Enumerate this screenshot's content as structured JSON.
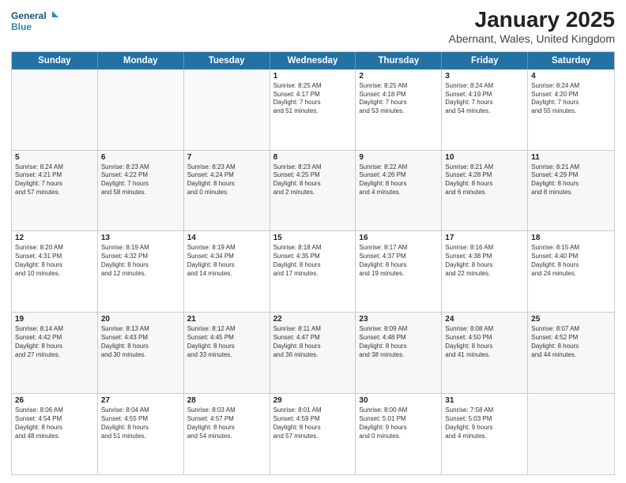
{
  "header": {
    "logo_line1": "General",
    "logo_line2": "Blue",
    "title": "January 2025",
    "subtitle": "Abernant, Wales, United Kingdom"
  },
  "days": [
    "Sunday",
    "Monday",
    "Tuesday",
    "Wednesday",
    "Thursday",
    "Friday",
    "Saturday"
  ],
  "weeks": [
    [
      {
        "day": "",
        "info": ""
      },
      {
        "day": "",
        "info": ""
      },
      {
        "day": "",
        "info": ""
      },
      {
        "day": "1",
        "info": "Sunrise: 8:25 AM\nSunset: 4:17 PM\nDaylight: 7 hours\nand 51 minutes."
      },
      {
        "day": "2",
        "info": "Sunrise: 8:25 AM\nSunset: 4:18 PM\nDaylight: 7 hours\nand 53 minutes."
      },
      {
        "day": "3",
        "info": "Sunrise: 8:24 AM\nSunset: 4:19 PM\nDaylight: 7 hours\nand 54 minutes."
      },
      {
        "day": "4",
        "info": "Sunrise: 8:24 AM\nSunset: 4:20 PM\nDaylight: 7 hours\nand 55 minutes."
      }
    ],
    [
      {
        "day": "5",
        "info": "Sunrise: 8:24 AM\nSunset: 4:21 PM\nDaylight: 7 hours\nand 57 minutes."
      },
      {
        "day": "6",
        "info": "Sunrise: 8:23 AM\nSunset: 4:22 PM\nDaylight: 7 hours\nand 58 minutes."
      },
      {
        "day": "7",
        "info": "Sunrise: 8:23 AM\nSunset: 4:24 PM\nDaylight: 8 hours\nand 0 minutes."
      },
      {
        "day": "8",
        "info": "Sunrise: 8:23 AM\nSunset: 4:25 PM\nDaylight: 8 hours\nand 2 minutes."
      },
      {
        "day": "9",
        "info": "Sunrise: 8:22 AM\nSunset: 4:26 PM\nDaylight: 8 hours\nand 4 minutes."
      },
      {
        "day": "10",
        "info": "Sunrise: 8:21 AM\nSunset: 4:28 PM\nDaylight: 8 hours\nand 6 minutes."
      },
      {
        "day": "11",
        "info": "Sunrise: 8:21 AM\nSunset: 4:29 PM\nDaylight: 8 hours\nand 8 minutes."
      }
    ],
    [
      {
        "day": "12",
        "info": "Sunrise: 8:20 AM\nSunset: 4:31 PM\nDaylight: 8 hours\nand 10 minutes."
      },
      {
        "day": "13",
        "info": "Sunrise: 8:19 AM\nSunset: 4:32 PM\nDaylight: 8 hours\nand 12 minutes."
      },
      {
        "day": "14",
        "info": "Sunrise: 8:19 AM\nSunset: 4:34 PM\nDaylight: 8 hours\nand 14 minutes."
      },
      {
        "day": "15",
        "info": "Sunrise: 8:18 AM\nSunset: 4:35 PM\nDaylight: 8 hours\nand 17 minutes."
      },
      {
        "day": "16",
        "info": "Sunrise: 8:17 AM\nSunset: 4:37 PM\nDaylight: 8 hours\nand 19 minutes."
      },
      {
        "day": "17",
        "info": "Sunrise: 8:16 AM\nSunset: 4:38 PM\nDaylight: 8 hours\nand 22 minutes."
      },
      {
        "day": "18",
        "info": "Sunrise: 8:15 AM\nSunset: 4:40 PM\nDaylight: 8 hours\nand 24 minutes."
      }
    ],
    [
      {
        "day": "19",
        "info": "Sunrise: 8:14 AM\nSunset: 4:42 PM\nDaylight: 8 hours\nand 27 minutes."
      },
      {
        "day": "20",
        "info": "Sunrise: 8:13 AM\nSunset: 4:43 PM\nDaylight: 8 hours\nand 30 minutes."
      },
      {
        "day": "21",
        "info": "Sunrise: 8:12 AM\nSunset: 4:45 PM\nDaylight: 8 hours\nand 33 minutes."
      },
      {
        "day": "22",
        "info": "Sunrise: 8:11 AM\nSunset: 4:47 PM\nDaylight: 8 hours\nand 36 minutes."
      },
      {
        "day": "23",
        "info": "Sunrise: 8:09 AM\nSunset: 4:48 PM\nDaylight: 8 hours\nand 38 minutes."
      },
      {
        "day": "24",
        "info": "Sunrise: 8:08 AM\nSunset: 4:50 PM\nDaylight: 8 hours\nand 41 minutes."
      },
      {
        "day": "25",
        "info": "Sunrise: 8:07 AM\nSunset: 4:52 PM\nDaylight: 8 hours\nand 44 minutes."
      }
    ],
    [
      {
        "day": "26",
        "info": "Sunrise: 8:06 AM\nSunset: 4:54 PM\nDaylight: 8 hours\nand 48 minutes."
      },
      {
        "day": "27",
        "info": "Sunrise: 8:04 AM\nSunset: 4:55 PM\nDaylight: 8 hours\nand 51 minutes."
      },
      {
        "day": "28",
        "info": "Sunrise: 8:03 AM\nSunset: 4:57 PM\nDaylight: 8 hours\nand 54 minutes."
      },
      {
        "day": "29",
        "info": "Sunrise: 8:01 AM\nSunset: 4:59 PM\nDaylight: 8 hours\nand 57 minutes."
      },
      {
        "day": "30",
        "info": "Sunrise: 8:00 AM\nSunset: 5:01 PM\nDaylight: 9 hours\nand 0 minutes."
      },
      {
        "day": "31",
        "info": "Sunrise: 7:58 AM\nSunset: 5:03 PM\nDaylight: 9 hours\nand 4 minutes."
      },
      {
        "day": "",
        "info": ""
      }
    ]
  ]
}
